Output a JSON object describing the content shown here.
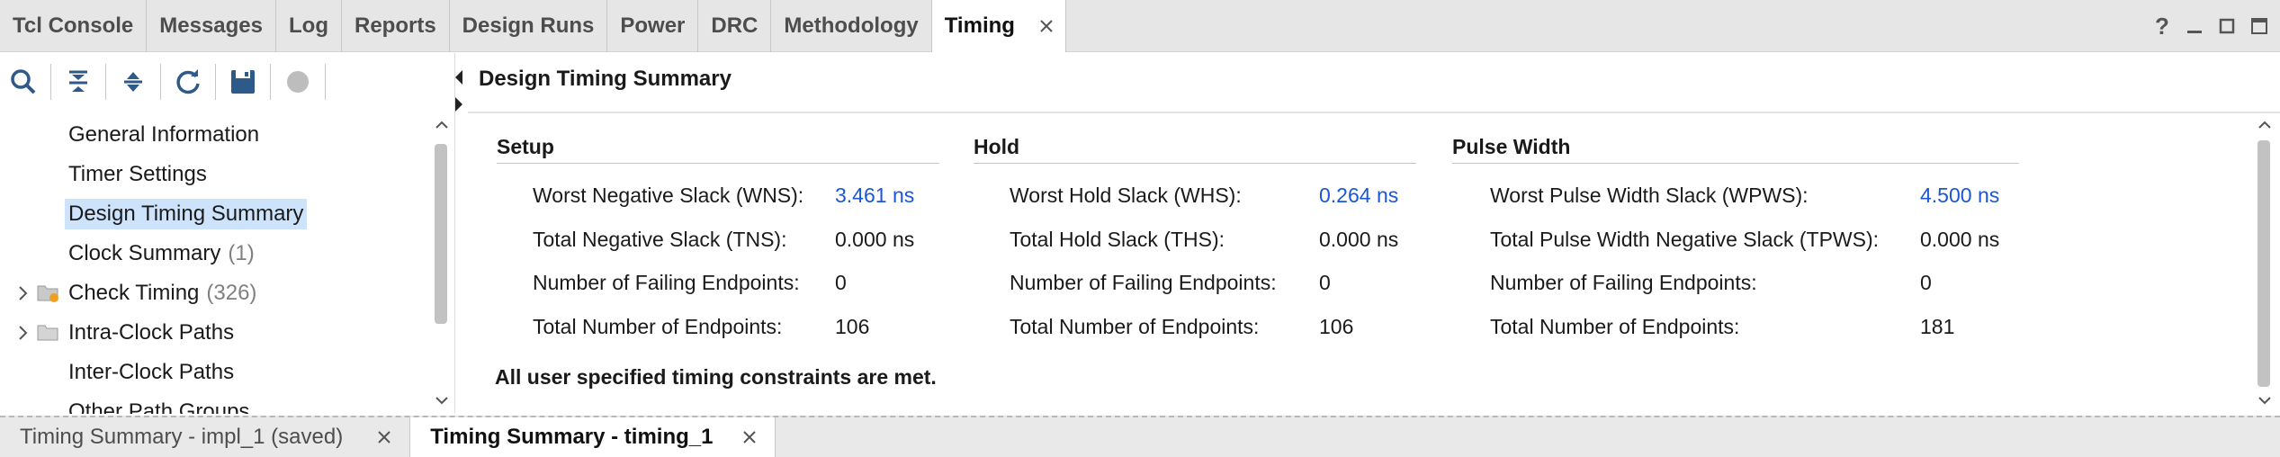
{
  "top_tabs": [
    {
      "label": "Tcl Console"
    },
    {
      "label": "Messages"
    },
    {
      "label": "Log"
    },
    {
      "label": "Reports"
    },
    {
      "label": "Design Runs"
    },
    {
      "label": "Power"
    },
    {
      "label": "DRC"
    },
    {
      "label": "Methodology"
    },
    {
      "label": "Timing",
      "active": true
    }
  ],
  "window_controls": {
    "help": "?",
    "minimize": "minimize",
    "restore": "restore",
    "maximize": "maximize"
  },
  "toolbar_icons": [
    "search-icon",
    "collapse-all-icon",
    "expand-all-icon",
    "refresh-icon",
    "save-icon",
    "stop-icon"
  ],
  "nav": {
    "items": [
      {
        "label": "General Information"
      },
      {
        "label": "Timer Settings"
      },
      {
        "label": "Design Timing Summary",
        "selected": true
      },
      {
        "label": "Clock Summary",
        "count": "(1)"
      },
      {
        "label": "Check Timing",
        "count": "(326)",
        "expandable": true
      },
      {
        "label": "Intra-Clock Paths",
        "expandable": true
      },
      {
        "label": "Inter-Clock Paths"
      },
      {
        "label": "Other Path Groups"
      }
    ]
  },
  "panel_title": "Design Timing Summary",
  "setup": {
    "header": "Setup",
    "rows": [
      {
        "label": "Worst Negative Slack (WNS):",
        "value": "3.461 ns",
        "link": true
      },
      {
        "label": "Total Negative Slack (TNS):",
        "value": "0.000 ns"
      },
      {
        "label": "Number of Failing Endpoints:",
        "value": "0"
      },
      {
        "label": "Total Number of Endpoints:",
        "value": "106"
      }
    ]
  },
  "hold": {
    "header": "Hold",
    "rows": [
      {
        "label": "Worst Hold Slack (WHS):",
        "value": "0.264 ns",
        "link": true
      },
      {
        "label": "Total Hold Slack (THS):",
        "value": "0.000 ns"
      },
      {
        "label": "Number of Failing Endpoints:",
        "value": "0"
      },
      {
        "label": "Total Number of Endpoints:",
        "value": "106"
      }
    ]
  },
  "pulse_width": {
    "header": "Pulse Width",
    "rows": [
      {
        "label": "Worst Pulse Width Slack (WPWS):",
        "value": "4.500 ns",
        "link": true
      },
      {
        "label": "Total Pulse Width Negative Slack (TPWS):",
        "value": "0.000 ns"
      },
      {
        "label": "Number of Failing Endpoints:",
        "value": "0"
      },
      {
        "label": "Total Number of Endpoints:",
        "value": "181"
      }
    ]
  },
  "summary_message": "All user specified timing constraints are met.",
  "bottom_tabs": [
    {
      "label": "Timing Summary - impl_1 (saved)"
    },
    {
      "label": "Timing Summary - timing_1",
      "active": true
    }
  ],
  "colors": {
    "link": "#1a56d6",
    "selection": "#cde3fb",
    "tab_bar": "#e6e6e6"
  }
}
